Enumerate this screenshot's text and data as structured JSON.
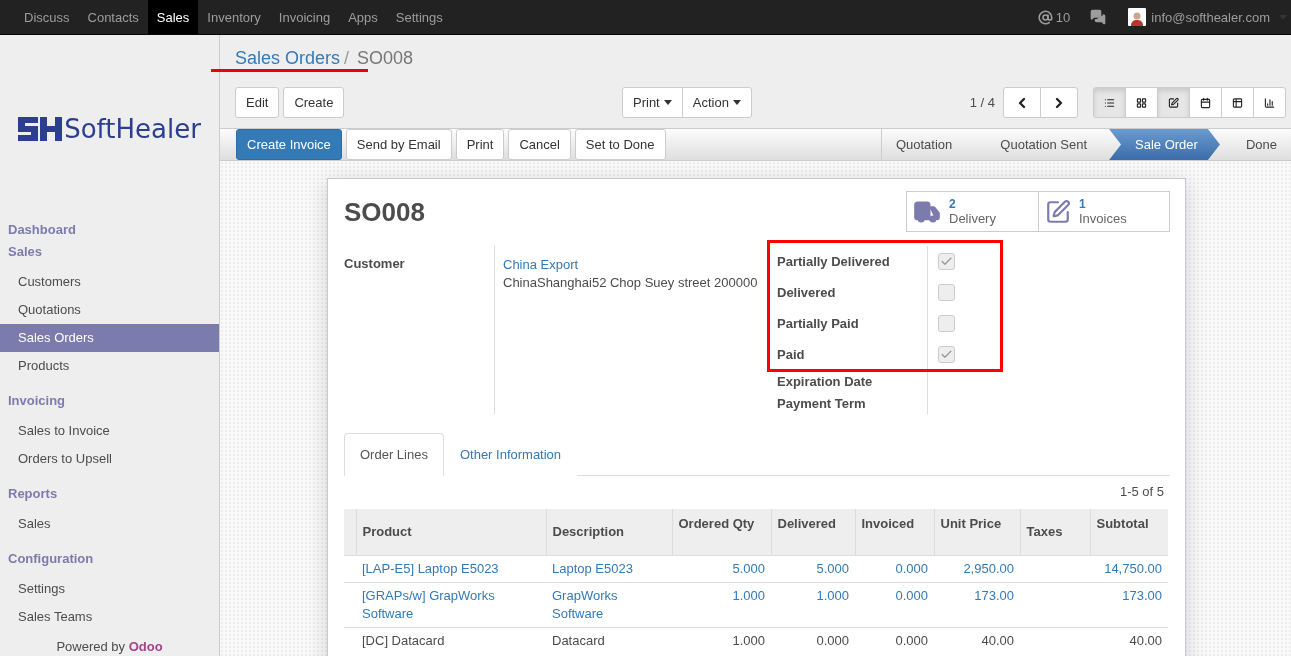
{
  "navbar": {
    "apps": [
      {
        "label": "Discuss",
        "selected": false
      },
      {
        "label": "Contacts",
        "selected": false
      },
      {
        "label": "Sales",
        "selected": true
      },
      {
        "label": "Inventory",
        "selected": false
      },
      {
        "label": "Invoicing",
        "selected": false
      },
      {
        "label": "Apps",
        "selected": false
      },
      {
        "label": "Settings",
        "selected": false
      }
    ],
    "mentions": "10",
    "user": "info@softhealer.com"
  },
  "logo": "SoftHealer",
  "sidebar": {
    "sections": [
      {
        "title": "Dashboard"
      },
      {
        "title": "Sales",
        "items": [
          {
            "label": "Customers",
            "selected": false
          },
          {
            "label": "Quotations",
            "selected": false
          },
          {
            "label": "Sales Orders",
            "selected": true
          },
          {
            "label": "Products",
            "selected": false
          }
        ]
      },
      {
        "title": "Invoicing",
        "items": [
          {
            "label": "Sales to Invoice",
            "selected": false
          },
          {
            "label": "Orders to Upsell",
            "selected": false
          }
        ]
      },
      {
        "title": "Reports",
        "items": [
          {
            "label": "Sales",
            "selected": false
          }
        ]
      },
      {
        "title": "Configuration",
        "items": [
          {
            "label": "Settings",
            "selected": false
          },
          {
            "label": "Sales Teams",
            "selected": false
          }
        ]
      }
    ],
    "powered_by": "Powered by",
    "brand": "Odoo"
  },
  "breadcrumb": {
    "parent": "Sales Orders",
    "separator": "/",
    "current": "SO008"
  },
  "buttons": [
    "Edit",
    "Create"
  ],
  "dropdowns": [
    "Print",
    "Action"
  ],
  "pager": "1 / 4",
  "views": [
    {
      "kind": "list",
      "selected": true
    },
    {
      "kind": "kanban",
      "selected": false
    },
    {
      "kind": "form",
      "selected": true
    },
    {
      "kind": "calendar",
      "selected": false
    },
    {
      "kind": "pivot",
      "selected": false
    },
    {
      "kind": "graph",
      "selected": false
    }
  ],
  "actions": [
    {
      "label": "Create Invoice",
      "primary": true
    },
    {
      "label": "Send by Email",
      "primary": false
    },
    {
      "label": "Print",
      "primary": false
    },
    {
      "label": "Cancel",
      "primary": false
    },
    {
      "label": "Set to Done",
      "primary": false
    }
  ],
  "stages": [
    {
      "label": "Quotation",
      "selected": false
    },
    {
      "label": "Quotation Sent",
      "selected": false
    },
    {
      "label": "Sale Order",
      "selected": true
    },
    {
      "label": "Done",
      "selected": false
    }
  ],
  "smart_buttons": [
    {
      "kind": "delivery",
      "count": "2",
      "label": "Delivery"
    },
    {
      "kind": "invoices",
      "count": "1",
      "label": "Invoices"
    }
  ],
  "record": {
    "name": "SO008",
    "customer_label": "Customer",
    "customer_name": "China Export",
    "customer_address": "ChinaShanghai52 Chop Suey street 200000"
  },
  "fields": [
    {
      "kind": "checkbox",
      "label": "Partially Delivered",
      "checked": true
    },
    {
      "kind": "checkbox",
      "label": "Delivered",
      "checked": false
    },
    {
      "kind": "checkbox",
      "label": "Partially Paid",
      "checked": false
    },
    {
      "kind": "checkbox",
      "label": "Paid",
      "checked": true
    },
    {
      "kind": "text",
      "label": "Expiration Date"
    },
    {
      "kind": "text",
      "label": "Payment Term"
    }
  ],
  "tabs": [
    {
      "label": "Order Lines",
      "selected": true
    },
    {
      "label": "Other Information",
      "selected": false
    }
  ],
  "table": {
    "pager": "1-5 of 5",
    "columns": [
      "Product",
      "Description",
      "Ordered Qty",
      "Delivered",
      "Invoiced",
      "Unit Price",
      "Taxes",
      "Subtotal"
    ],
    "rows": [
      {
        "kind": "link",
        "cells": [
          "[LAP-E5] Laptop E5023",
          "Laptop E5023",
          "5.000",
          "5.000",
          "0.000",
          "2,950.00",
          null,
          "14,750.00"
        ]
      },
      {
        "kind": "link",
        "cells": [
          "[GRAPs/w] GrapWorks Software",
          "GrapWorks Software",
          "1.000",
          "1.000",
          "0.000",
          "173.00",
          null,
          "173.00"
        ]
      },
      {
        "kind": "plain",
        "cells": [
          "[DC] Datacard",
          "Datacard",
          "1.000",
          "0.000",
          "0.000",
          "40.00",
          null,
          "40.00"
        ]
      }
    ]
  }
}
